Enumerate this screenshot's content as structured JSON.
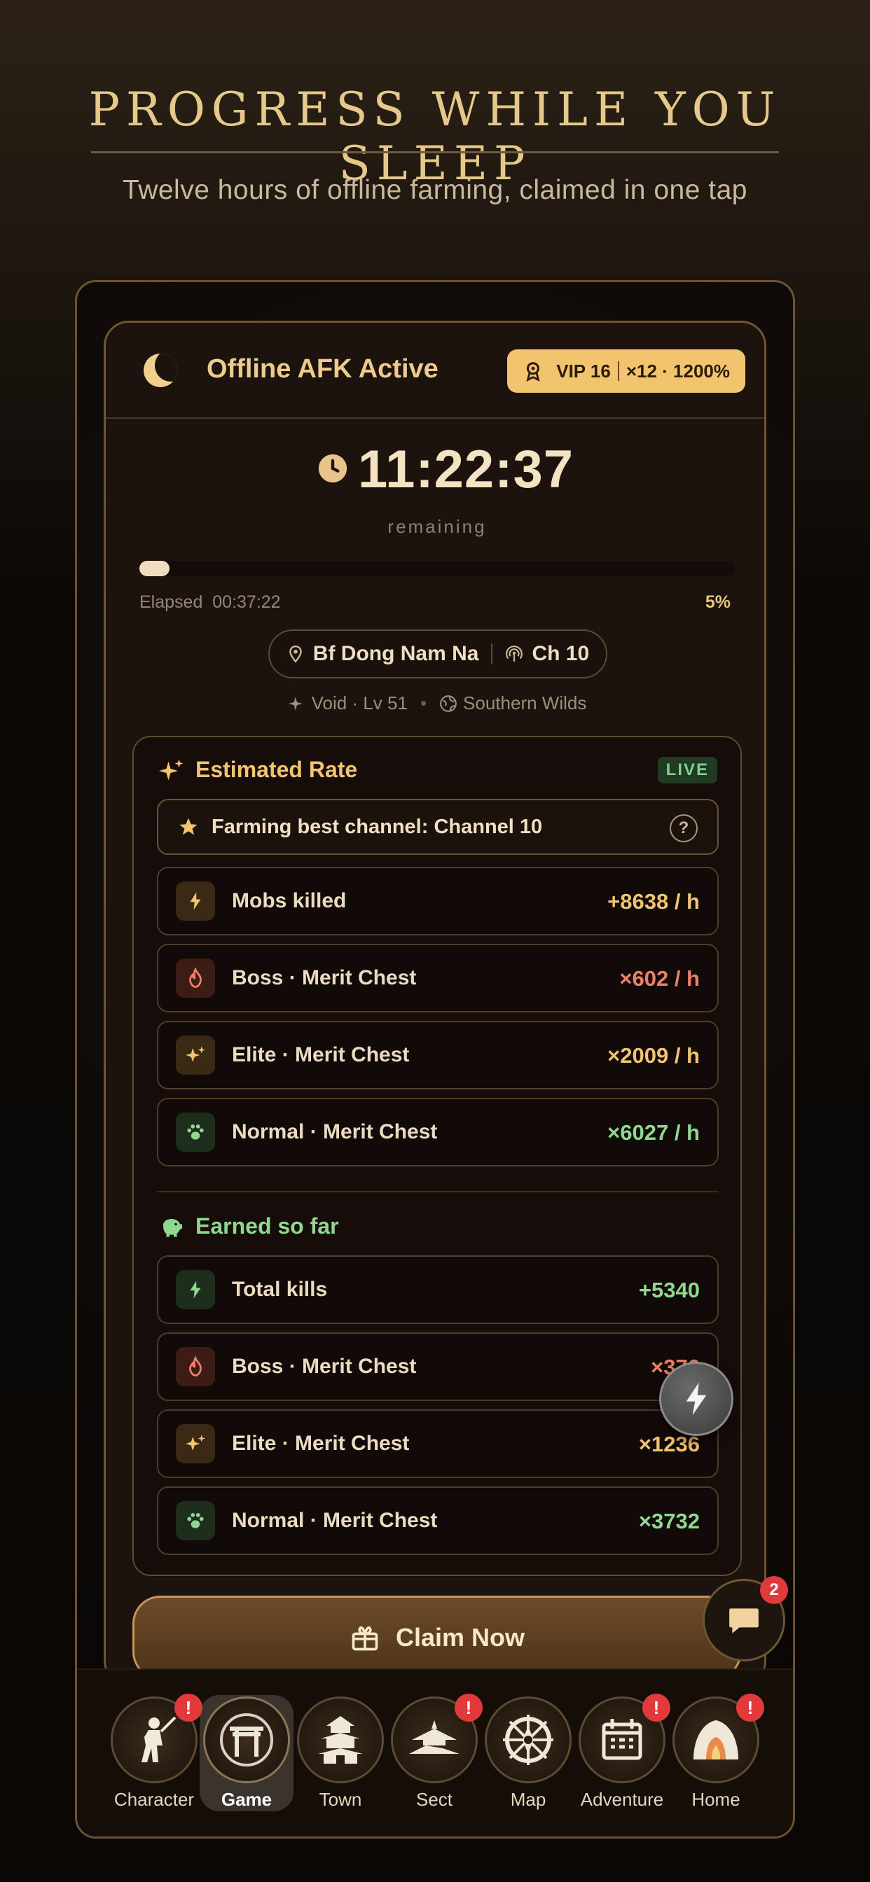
{
  "hero": {
    "title": "PROGRESS WHILE YOU SLEEP",
    "subtitle": "Twelve hours of offline farming, claimed in one tap"
  },
  "header": {
    "title": "Offline AFK Active",
    "vip_level": "VIP 16",
    "vip_multiplier": "×12 · 1200%"
  },
  "timer": {
    "value": "11:22:37",
    "label": "remaining",
    "progress": 0.05,
    "elapsed_label": "Elapsed",
    "elapsed_value": "00:37:22",
    "percent_text": "5%"
  },
  "location": {
    "name": "Bf Dong Nam Na",
    "channel": "Ch 10",
    "realm": "Void · Lv 51",
    "region": "Southern Wilds"
  },
  "estimated": {
    "title": "Estimated Rate",
    "live_badge": "LIVE",
    "best_channel": "Farming best channel: Channel 10",
    "help": "?",
    "rows": [
      {
        "label": "Mobs killed",
        "value": "+8638 / h"
      },
      {
        "label": "Boss · Merit Chest",
        "value": "×602 / h"
      },
      {
        "label": "Elite · Merit Chest",
        "value": "×2009 / h"
      },
      {
        "label": "Normal · Merit Chest",
        "value": "×6027 / h"
      }
    ]
  },
  "earned": {
    "title": "Earned so far",
    "rows": [
      {
        "label": "Total kills",
        "value": "+5340"
      },
      {
        "label": "Boss · Merit Chest",
        "value": "×376"
      },
      {
        "label": "Elite · Merit Chest",
        "value": "×1236"
      },
      {
        "label": "Normal · Merit Chest",
        "value": "×3732"
      }
    ]
  },
  "claim_label": "Claim Now",
  "chat_badge": "2",
  "nav": {
    "items": [
      {
        "label": "Character",
        "badge": "!"
      },
      {
        "label": "Game",
        "badge": ""
      },
      {
        "label": "Town",
        "badge": ""
      },
      {
        "label": "Sect",
        "badge": "!"
      },
      {
        "label": "Map",
        "badge": ""
      },
      {
        "label": "Adventure",
        "badge": "!"
      },
      {
        "label": "Home",
        "badge": "!"
      }
    ]
  },
  "colors": {
    "accent_gold": "#f2c470",
    "boss_red": "#ee8068",
    "normal_green": "#8fd890",
    "vip_badge": "#f2c46e"
  }
}
